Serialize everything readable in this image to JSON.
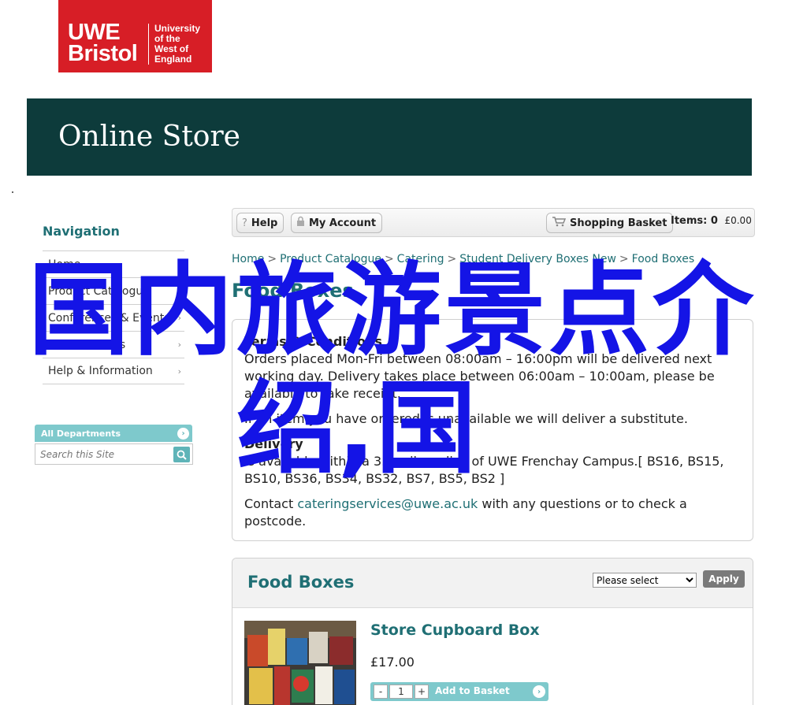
{
  "logo": {
    "name_line1": "UWE",
    "name_line2": "Bristol",
    "uni_line1": "University",
    "uni_line2": "of the",
    "uni_line3": "West of",
    "uni_line4": "England",
    "color": "#d71e26"
  },
  "banner": {
    "title": "Online Store",
    "color": "#0d3b3b"
  },
  "sidebar": {
    "heading": "Navigation",
    "items": [
      {
        "label": "Home",
        "has_submenu": false
      },
      {
        "label": "Product Catalogue",
        "has_submenu": true
      },
      {
        "label": "Conferences & Events",
        "has_submenu": true
      },
      {
        "label": "Short Courses",
        "has_submenu": true
      },
      {
        "label": "Help & Information",
        "has_submenu": true
      }
    ],
    "departments_label": "All Departments",
    "search_placeholder": "Search this Site"
  },
  "toolbar": {
    "help_label": "Help",
    "account_label": "My Account",
    "basket_label": "Shopping Basket",
    "items_label": "Items:",
    "items_count": "0",
    "items_total": "£0.00"
  },
  "breadcrumb": [
    "Home",
    "Product Catalogue",
    "Catering",
    "Student Delivery Boxes New",
    "Food Boxes"
  ],
  "page_title": "Food Boxes",
  "terms": {
    "heading": "Terms & Conditions",
    "orders": "Orders placed Mon-Fri between 08:00am – 16:00pm will be delivered next working day. Delivery takes place between 06:00am – 10:00am, please be available to take receipt.",
    "substitute": "If an item you have ordered is unavailable we will deliver a substitute.",
    "delivery_heading": "Delivery",
    "delivery_text": "Is available within a 3.5 mile radius of UWE Frenchay Campus.[ BS16, BS15, BS10, BS36, BS34, BS32, BS7, BS5, BS2 ]",
    "contact_prefix": "Contact ",
    "contact_email": "cateringservices@uwe.ac.uk",
    "contact_suffix": " with any questions or to check a postcode."
  },
  "panel": {
    "title": "Food Boxes",
    "sort_selected": "Please select",
    "apply_label": "Apply"
  },
  "product": {
    "name": "Store Cupboard Box",
    "price": "£17.00",
    "quantity": "1",
    "minus": "-",
    "plus": "+",
    "add_label": "Add to Basket"
  },
  "overlay": {
    "line1": "国内旅游景点介",
    "line2": "绍,国",
    "color": "#1414e6"
  },
  "accent_color": "#1f6f74"
}
